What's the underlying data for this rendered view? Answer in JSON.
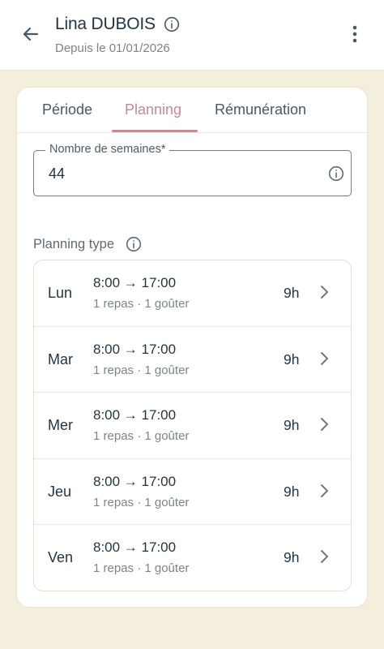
{
  "header": {
    "title": "Lina DUBOIS",
    "subtitle": "Depuis le 01/01/2026",
    "back_icon": "arrow-left-icon",
    "info_icon": "info-icon",
    "menu_icon": "more-vertical-icon"
  },
  "tabs": [
    {
      "label": "Période",
      "active": false
    },
    {
      "label": "Planning",
      "active": true
    },
    {
      "label": "Rémunération",
      "active": false
    }
  ],
  "weeks_field": {
    "label": "Nombre de semaines*",
    "value": "44"
  },
  "planning": {
    "title": "Planning type",
    "days": [
      {
        "day": "Lun",
        "time": "8:00 → 17:00",
        "meals": "1 repas · 1 goûter",
        "hours": "9h"
      },
      {
        "day": "Mar",
        "time": "8:00 → 17:00",
        "meals": "1 repas · 1 goûter",
        "hours": "9h"
      },
      {
        "day": "Mer",
        "time": "8:00 → 17:00",
        "meals": "1 repas · 1 goûter",
        "hours": "9h"
      },
      {
        "day": "Jeu",
        "time": "8:00 → 17:00",
        "meals": "1 repas · 1 goûter",
        "hours": "9h"
      },
      {
        "day": "Ven",
        "time": "8:00 → 17:00",
        "meals": "1 repas · 1 goûter",
        "hours": "9h"
      }
    ]
  },
  "colors": {
    "background": "#f3efdc",
    "accent": "#c68a96",
    "text": "#1f3444"
  }
}
